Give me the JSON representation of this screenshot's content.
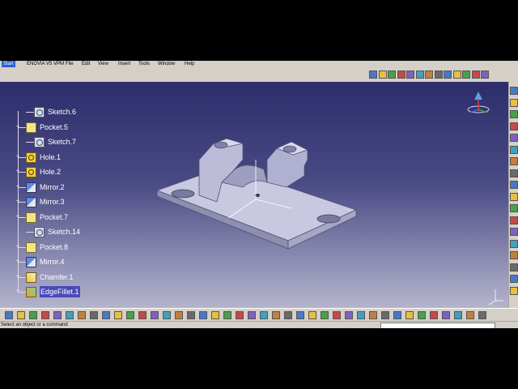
{
  "menu": {
    "items": [
      "Start",
      "ENOVIA V5 VPM",
      "File",
      "Edit",
      "View",
      "Insert",
      "Tools",
      "Window",
      "Help"
    ]
  },
  "tree": {
    "nodes": [
      {
        "label": "Sketch.6",
        "type": "sketch-icon",
        "level": 2
      },
      {
        "label": "Pocket.5",
        "type": "pocket-icon",
        "level": 1
      },
      {
        "label": "Sketch.7",
        "type": "sketch-icon",
        "level": 2
      },
      {
        "label": "Hole.1",
        "type": "hole-icon",
        "level": 1
      },
      {
        "label": "Hole.2",
        "type": "hole-icon",
        "level": 1
      },
      {
        "label": "Mirror.2",
        "type": "mirror-icon",
        "level": 1
      },
      {
        "label": "Mirror.3",
        "type": "mirror-icon",
        "level": 1
      },
      {
        "label": "Pocket.7",
        "type": "pocket-icon",
        "level": 1
      },
      {
        "label": "Sketch.14",
        "type": "sketch-icon",
        "level": 2
      },
      {
        "label": "Pocket.8",
        "type": "pocket-icon",
        "level": 1
      },
      {
        "label": "Mirror.4",
        "type": "mirror-icon",
        "level": 1
      },
      {
        "label": "Chamfer.1",
        "type": "chamfer-icon",
        "level": 1
      },
      {
        "label": "EdgeFillet.1",
        "type": "edgefillet-icon",
        "level": 1,
        "selected": true
      }
    ]
  },
  "status": {
    "message": "Select an object or a command"
  },
  "colors": {
    "viewport_top": "#2d2d6c",
    "viewport_bottom": "#b4b4cc",
    "part_face": "#c8c8e0",
    "part_edge": "#505070",
    "toolbar_bg": "#d4d0c8"
  }
}
